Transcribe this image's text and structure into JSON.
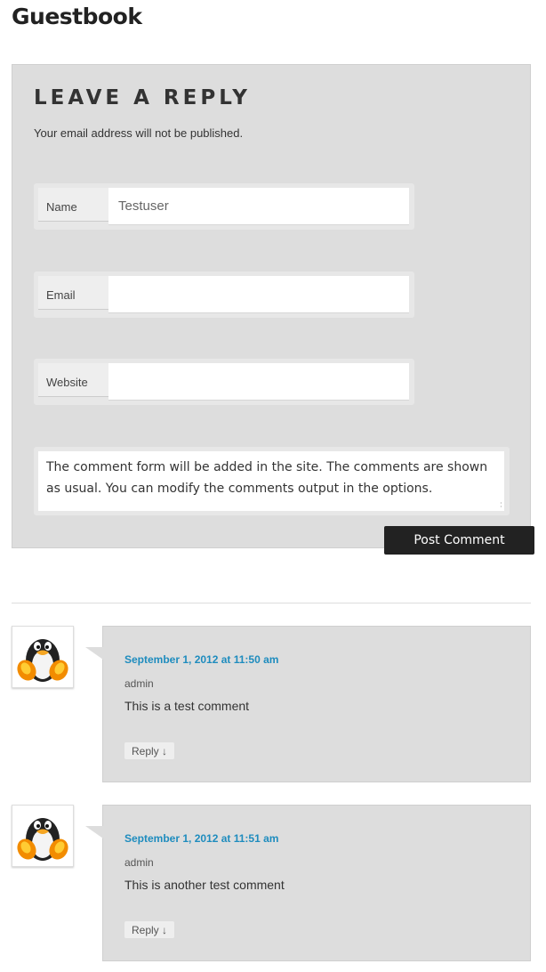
{
  "page": {
    "title": "Guestbook"
  },
  "reply_form": {
    "heading": "LEAVE A REPLY",
    "note": "Your email address will not be published.",
    "fields": [
      {
        "label": "Name",
        "value": "Testuser"
      },
      {
        "label": "Email",
        "value": ""
      },
      {
        "label": "Website",
        "value": ""
      }
    ],
    "comment_text": "The comment form will be added in the site. The comments are shown as usual. You can modify the comments output in the options.",
    "submit_label": "Post Comment"
  },
  "comments": [
    {
      "date": "September 1, 2012 at 11:50 am",
      "author": "admin",
      "text": "This is a test comment",
      "reply_label": "Reply ↓",
      "avatar_icon": "penguin-avatar-icon"
    },
    {
      "date": "September 1, 2012 at 11:51 am",
      "author": "admin",
      "text": "This is another test comment",
      "reply_label": "Reply ↓",
      "avatar_icon": "penguin-avatar-icon"
    }
  ],
  "colors": {
    "panel": "#dddddd",
    "link": "#1e8cbe",
    "button": "#222222"
  }
}
